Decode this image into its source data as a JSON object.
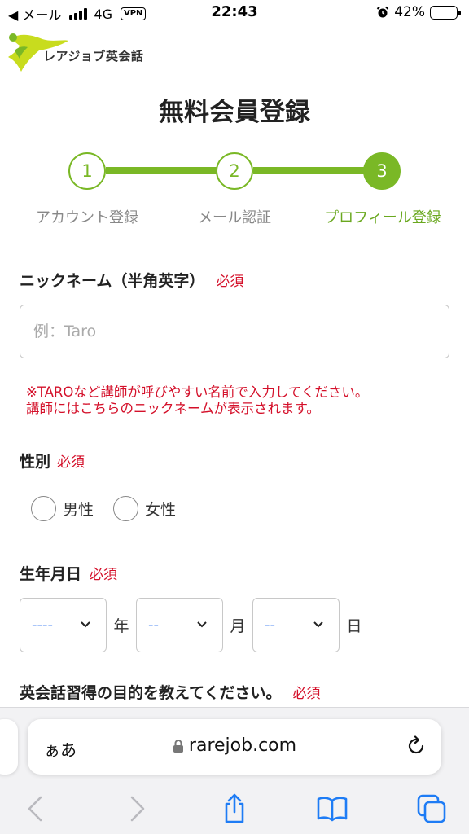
{
  "status_bar": {
    "carrier": "◀ メール",
    "network": "4G",
    "vpn": "VPN",
    "time": "22:43",
    "battery": "42%",
    "battery_level": 0.42
  },
  "logo": {
    "text": "レアジョブ英会話"
  },
  "page": {
    "title": "無料会員登録"
  },
  "stepper": {
    "steps": [
      {
        "number": "1",
        "label": "アカウント登録"
      },
      {
        "number": "2",
        "label": "メール認証"
      },
      {
        "number": "3",
        "label": "プロフィール登録"
      }
    ],
    "current_step": 3
  },
  "form": {
    "required_label": "必須",
    "nickname": {
      "label": "ニックネーム（半角英字）",
      "placeholder": "例：Taro",
      "value": ""
    },
    "note_line1": "※TAROなど講師が呼びやすい名前で入力してください。",
    "note_line2": "講師にはこちらのニックネームが表示されます。",
    "gender": {
      "label": "性別",
      "options": [
        "男性",
        "女性"
      ]
    },
    "birthday": {
      "label": "生年月日",
      "year_value": "----",
      "month_value": "--",
      "day_value": "--",
      "year_unit": "年",
      "month_unit": "月",
      "day_unit": "日"
    },
    "purpose": {
      "label": "英会話習得の目的を教えてください。"
    }
  },
  "browser": {
    "aa": "ぁあ",
    "url": "rarejob.com"
  },
  "colors": {
    "accent_green": "#7ab826",
    "required_red": "#d4102a",
    "select_blue": "#3b7cf2",
    "ios_blue": "#1e7cf5"
  }
}
